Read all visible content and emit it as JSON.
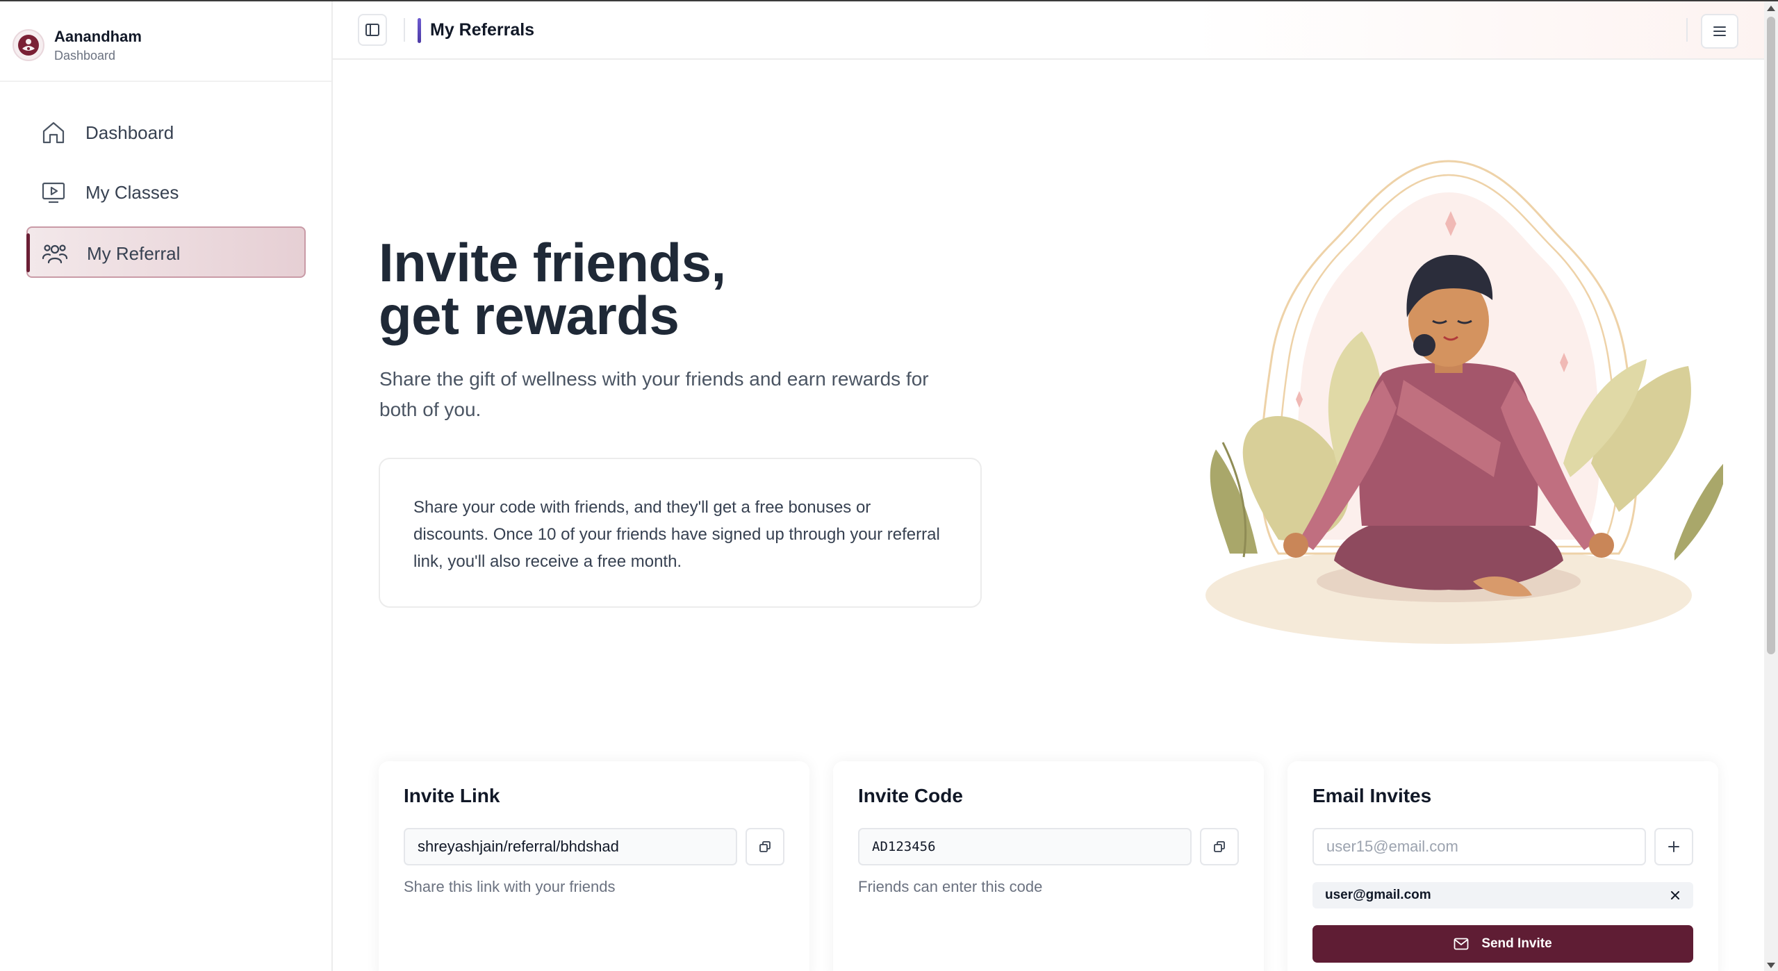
{
  "brand": {
    "name": "Aanandham",
    "subtitle": "Dashboard"
  },
  "sidebar": {
    "items": [
      {
        "label": "Dashboard",
        "icon": "home-icon",
        "active": false
      },
      {
        "label": "My Classes",
        "icon": "play-screen-icon",
        "active": false
      },
      {
        "label": "My Referral",
        "icon": "users-icon",
        "active": true
      }
    ]
  },
  "header": {
    "title": "My Referrals"
  },
  "hero": {
    "title_line1": "Invite friends,",
    "title_line2": "get rewards",
    "subtitle": "Share the gift of wellness with your friends and earn rewards for both of you.",
    "info": "Share your code with friends, and they'll get a free bonuses or discounts. Once 10 of your friends have signed up through your referral link, you'll also receive a free month."
  },
  "invite_link": {
    "title": "Invite Link",
    "value": "shreyashjain/referral/bhdshad",
    "hint": "Share this link with your friends"
  },
  "invite_code": {
    "title": "Invite Code",
    "value": "AD123456",
    "hint": "Friends can enter this code"
  },
  "email_invites": {
    "title": "Email Invites",
    "placeholder": "user15@email.com",
    "emails": [
      "user@gmail.com"
    ],
    "send_label": "Send Invite"
  },
  "colors": {
    "accent": "#5f1d34",
    "active_bg": "#ead5da",
    "header_accent": "#5a48bd"
  }
}
